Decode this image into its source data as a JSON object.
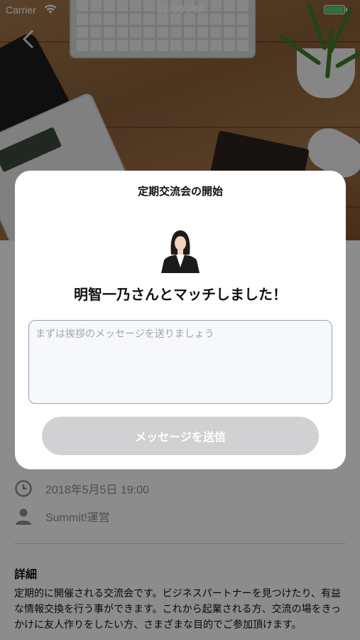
{
  "status_bar": {
    "carrier": "Carrier",
    "time": "12:00 PM",
    "battery_color": "#4cd964"
  },
  "nav": {
    "back_icon": "chevron-left-icon"
  },
  "event": {
    "datetime": "2018年5月5日 19:00",
    "organizer": "Summit!運営",
    "details_heading": "詳細",
    "details_body": "定期的に開催される交流会です。ビジネスパートナーを見つけたり、有益な情報交換を行う事ができます。これから起業される方、交流の場をきっかけに友人作りをしたい方、さまざまな目的でご参加頂けます。"
  },
  "modal": {
    "title": "定期交流会の開始",
    "match_text": "明智一乃さんとマッチしました！",
    "message_placeholder": "まずは挨拶のメッセージを送りましょう",
    "message_value": "",
    "send_label": "メッセージを送信"
  },
  "colors": {
    "overlay": "rgba(0,0,0,0.45)",
    "send_button_disabled": "#d1d1d4",
    "input_border": "#8fa3bd"
  }
}
